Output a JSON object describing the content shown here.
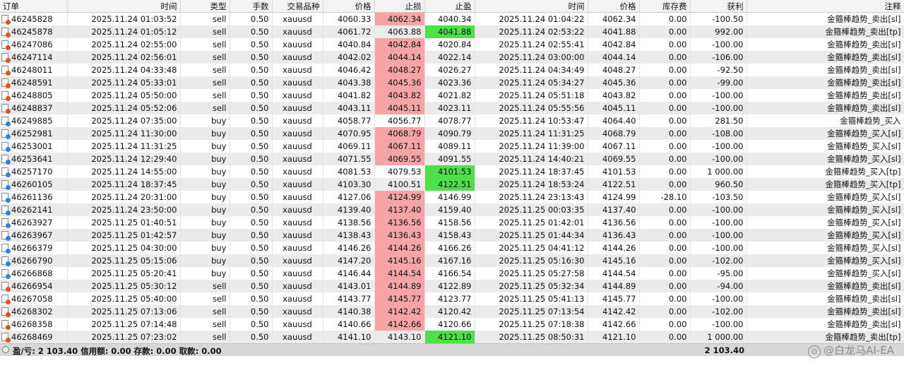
{
  "columns": [
    "订单",
    "时间",
    "类型",
    "手数",
    "交易品种",
    "价格",
    "止损",
    "止盈",
    "时间",
    "价格",
    "库存费",
    "获利",
    "注释"
  ],
  "rows": [
    [
      "46245828",
      "2025.11.24 01:03:52",
      "sell",
      "0.50",
      "xauusd",
      "4060.33",
      "4062.34",
      "4040.34",
      "2025.11.24 01:04:22",
      "4062.34",
      "0.00",
      "-100.50",
      "金箍棒趋势_卖出[sl]",
      "sl"
    ],
    [
      "46245878",
      "2025.11.24 01:05:12",
      "sell",
      "0.50",
      "xauusd",
      "4061.72",
      "4063.88",
      "4041.88",
      "2025.11.24 02:53:22",
      "4041.88",
      "0.00",
      "992.00",
      "金箍棒趋势_卖出[tp]",
      "tp"
    ],
    [
      "46247086",
      "2025.11.24 02:55:00",
      "sell",
      "0.50",
      "xauusd",
      "4040.84",
      "4042.84",
      "4020.84",
      "2025.11.24 02:55:41",
      "4042.84",
      "0.00",
      "-100.00",
      "金箍棒趋势_卖出[sl]",
      "sl"
    ],
    [
      "46247114",
      "2025.11.24 02:56:01",
      "sell",
      "0.50",
      "xauusd",
      "4042.02",
      "4044.14",
      "4022.14",
      "2025.11.24 03:00:00",
      "4044.14",
      "0.00",
      "-106.00",
      "金箍棒趋势_卖出[sl]",
      "sl"
    ],
    [
      "46248011",
      "2025.11.24 04:33:48",
      "sell",
      "0.50",
      "xauusd",
      "4046.42",
      "4048.27",
      "4026.27",
      "2025.11.24 04:34:49",
      "4048.27",
      "0.00",
      "-92.50",
      "金箍棒趋势_卖出[sl]",
      "sl"
    ],
    [
      "46248591",
      "2025.11.24 05:33:01",
      "sell",
      "0.50",
      "xauusd",
      "4043.38",
      "4045.36",
      "4023.36",
      "2025.11.24 05:34:27",
      "4045.36",
      "0.00",
      "-99.00",
      "金箍棒趋势_卖出[sl]",
      "sl"
    ],
    [
      "46248805",
      "2025.11.24 05:50:00",
      "sell",
      "0.50",
      "xauusd",
      "4041.82",
      "4043.82",
      "4021.82",
      "2025.11.24 05:51:18",
      "4043.82",
      "0.00",
      "-100.00",
      "金箍棒趋势_卖出[sl]",
      "sl"
    ],
    [
      "46248837",
      "2025.11.24 05:52:06",
      "sell",
      "0.50",
      "xauusd",
      "4043.11",
      "4045.11",
      "4023.11",
      "2025.11.24 05:55:56",
      "4045.11",
      "0.00",
      "-100.00",
      "金箍棒趋势_卖出[sl]",
      "sl"
    ],
    [
      "46249885",
      "2025.11.24 07:35:00",
      "buy",
      "0.50",
      "xauusd",
      "4058.77",
      "4056.77",
      "4078.77",
      "2025.11.24 10:53:47",
      "4064.40",
      "0.00",
      "281.50",
      "金箍棒趋势_买入",
      "none"
    ],
    [
      "46252981",
      "2025.11.24 11:30:00",
      "buy",
      "0.50",
      "xauusd",
      "4070.95",
      "4068.79",
      "4090.79",
      "2025.11.24 11:31:25",
      "4068.79",
      "0.00",
      "-108.00",
      "金箍棒趋势_买入[sl]",
      "sl"
    ],
    [
      "46253001",
      "2025.11.24 11:31:25",
      "buy",
      "0.50",
      "xauusd",
      "4069.11",
      "4067.11",
      "4089.11",
      "2025.11.24 11:39:00",
      "4067.11",
      "0.00",
      "-100.00",
      "金箍棒趋势_买入[sl]",
      "sl"
    ],
    [
      "46253641",
      "2025.11.24 12:29:40",
      "buy",
      "0.50",
      "xauusd",
      "4071.55",
      "4069.55",
      "4091.55",
      "2025.11.24 14:40:21",
      "4069.55",
      "0.00",
      "-100.00",
      "金箍棒趋势_买入[sl]",
      "sl"
    ],
    [
      "46257170",
      "2025.11.24 14:55:00",
      "buy",
      "0.50",
      "xauusd",
      "4081.53",
      "4079.53",
      "4101.53",
      "2025.11.24 18:37:45",
      "4101.53",
      "0.00",
      "1 000.00",
      "金箍棒趋势_买入[tp]",
      "tp"
    ],
    [
      "46260105",
      "2025.11.24 18:37:45",
      "buy",
      "0.50",
      "xauusd",
      "4103.30",
      "4100.51",
      "4122.51",
      "2025.11.24 18:53:24",
      "4122.51",
      "0.00",
      "960.50",
      "金箍棒趋势_买入[tp]",
      "tp"
    ],
    [
      "46261136",
      "2025.11.24 20:31:00",
      "buy",
      "0.50",
      "xauusd",
      "4127.06",
      "4124.99",
      "4146.99",
      "2025.11.24 23:13:43",
      "4124.99",
      "-28.10",
      "-103.50",
      "金箍棒趋势_买入[sl]",
      "sl"
    ],
    [
      "46262141",
      "2025.11.24 23:50:00",
      "buy",
      "0.50",
      "xauusd",
      "4139.40",
      "4137.40",
      "4159.40",
      "2025.11.25 00:03:35",
      "4137.40",
      "0.00",
      "-100.00",
      "金箍棒趋势_买入[sl]",
      "sl"
    ],
    [
      "46263927",
      "2025.11.25 01:40:51",
      "buy",
      "0.50",
      "xauusd",
      "4138.56",
      "4136.56",
      "4158.56",
      "2025.11.25 01:42:01",
      "4136.56",
      "0.00",
      "-100.00",
      "金箍棒趋势_买入[sl]",
      "sl"
    ],
    [
      "46263967",
      "2025.11.25 01:42:57",
      "buy",
      "0.50",
      "xauusd",
      "4138.43",
      "4136.43",
      "4158.43",
      "2025.11.25 01:44:34",
      "4136.43",
      "0.00",
      "-100.00",
      "金箍棒趋势_买入[sl]",
      "sl"
    ],
    [
      "46266379",
      "2025.11.25 04:30:00",
      "buy",
      "0.50",
      "xauusd",
      "4146.26",
      "4144.26",
      "4166.26",
      "2025.11.25 04:41:12",
      "4144.26",
      "0.00",
      "-100.00",
      "金箍棒趋势_买入[sl]",
      "sl"
    ],
    [
      "46266790",
      "2025.11.25 05:15:06",
      "buy",
      "0.50",
      "xauusd",
      "4147.20",
      "4145.16",
      "4167.16",
      "2025.11.25 05:16:30",
      "4145.16",
      "0.00",
      "-102.00",
      "金箍棒趋势_买入[sl]",
      "sl"
    ],
    [
      "46266868",
      "2025.11.25 05:20:41",
      "buy",
      "0.50",
      "xauusd",
      "4146.44",
      "4144.54",
      "4166.54",
      "2025.11.25 05:27:58",
      "4144.54",
      "0.00",
      "-95.00",
      "金箍棒趋势_买入[sl]",
      "sl"
    ],
    [
      "46266954",
      "2025.11.25 05:30:12",
      "sell",
      "0.50",
      "xauusd",
      "4143.01",
      "4144.89",
      "4122.89",
      "2025.11.25 05:32:34",
      "4144.89",
      "0.00",
      "-94.00",
      "金箍棒趋势_卖出[sl]",
      "sl"
    ],
    [
      "46267058",
      "2025.11.25 05:40:00",
      "sell",
      "0.50",
      "xauusd",
      "4143.77",
      "4145.77",
      "4123.77",
      "2025.11.25 05:41:13",
      "4145.77",
      "0.00",
      "-100.00",
      "金箍棒趋势_卖出[sl]",
      "sl"
    ],
    [
      "46268302",
      "2025.11.25 07:13:06",
      "sell",
      "0.50",
      "xauusd",
      "4140.38",
      "4142.42",
      "4120.42",
      "2025.11.25 07:13:54",
      "4142.42",
      "0.00",
      "-102.00",
      "金箍棒趋势_卖出[sl]",
      "sl"
    ],
    [
      "46268358",
      "2025.11.25 07:14:48",
      "sell",
      "0.50",
      "xauusd",
      "4140.66",
      "4142.66",
      "4120.66",
      "2025.11.25 07:18:38",
      "4142.66",
      "0.00",
      "-100.00",
      "金箍棒趋势_卖出[sl]",
      "sl"
    ],
    [
      "46268469",
      "2025.11.25 07:23:02",
      "sell",
      "0.50",
      "xauusd",
      "4141.10",
      "4143.10",
      "4121.10",
      "2025.11.25 08:50:31",
      "4121.10",
      "0.00",
      "1 000.00",
      "金箍棒趋势_卖出[tp]",
      "tp"
    ]
  ],
  "footer": {
    "summary": "盈/亏: 2 103.40  信用额: 0.00  存款: 0.00  取款: 0.00",
    "total_profit": "2 103.40"
  },
  "watermark": {
    "logo": "⊙",
    "text": "@白龙马AI-EA"
  },
  "colors": {
    "sl_hit": "#f6a4a4",
    "tp_hit": "#4ee04b",
    "alt_row": "#ebebeb",
    "footer_bg": "#d8d8d8"
  }
}
